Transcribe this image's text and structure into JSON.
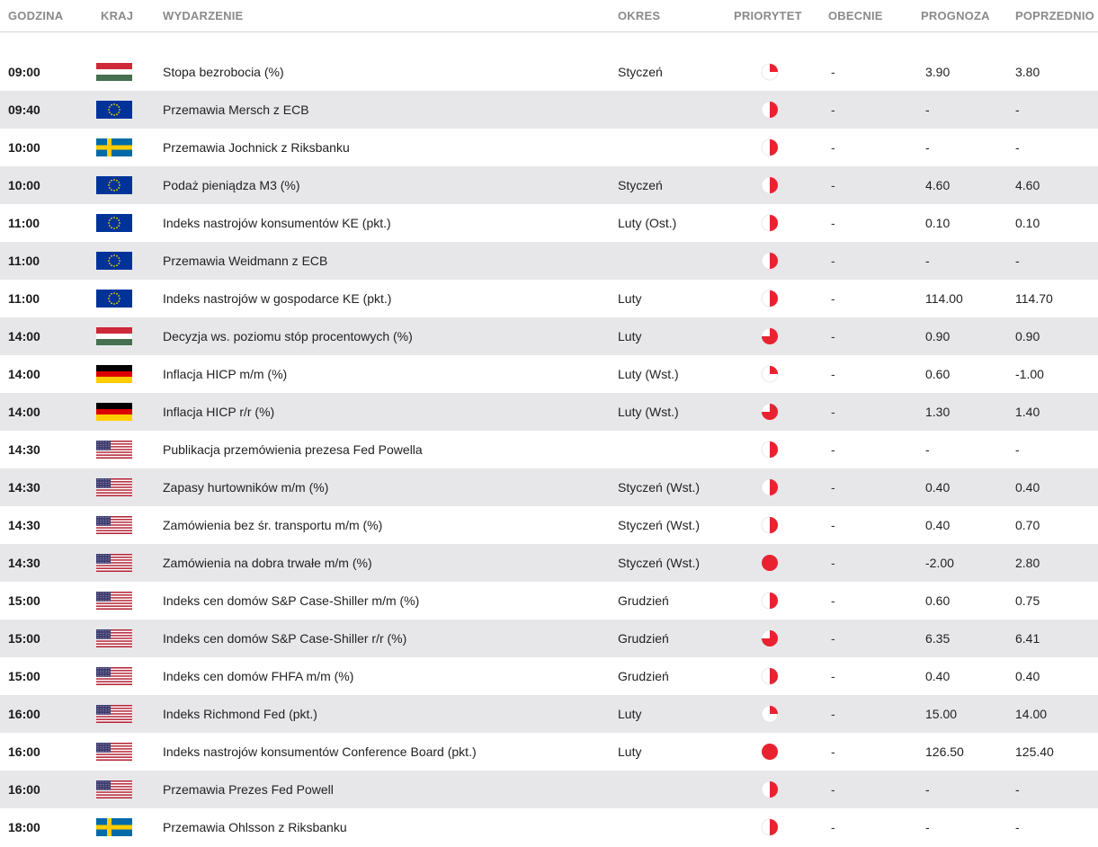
{
  "header": {
    "time": "GODZINA",
    "country": "KRAJ",
    "event": "WYDARZENIE",
    "period": "OKRES",
    "priority": "PRIORYTET",
    "current": "OBECNIE",
    "forecast": "PROGNOZA",
    "previous": "POPRZEDNIO"
  },
  "colors": {
    "priority_red": "#e8232f",
    "row_alt": "#e7e7ea",
    "header_text": "#8a8a8a"
  },
  "rows": [
    {
      "time": "09:00",
      "country": "hu",
      "event": "Stopa bezrobocia (%)",
      "period": "Styczeń",
      "priority": 1,
      "current": "-",
      "forecast": "3.90",
      "previous": "3.80"
    },
    {
      "time": "09:40",
      "country": "eu",
      "event": "Przemawia Mersch z ECB",
      "period": "",
      "priority": 2,
      "current": "-",
      "forecast": "-",
      "previous": "-"
    },
    {
      "time": "10:00",
      "country": "se",
      "event": "Przemawia Jochnick z Riksbanku",
      "period": "",
      "priority": 2,
      "current": "-",
      "forecast": "-",
      "previous": "-"
    },
    {
      "time": "10:00",
      "country": "eu",
      "event": "Podaż pieniądza M3 (%)",
      "period": "Styczeń",
      "priority": 2,
      "current": "-",
      "forecast": "4.60",
      "previous": "4.60"
    },
    {
      "time": "11:00",
      "country": "eu",
      "event": "Indeks nastrojów konsumentów KE (pkt.)",
      "period": "Luty (Ost.)",
      "priority": 2,
      "current": "-",
      "forecast": "0.10",
      "previous": "0.10"
    },
    {
      "time": "11:00",
      "country": "eu",
      "event": "Przemawia Weidmann z ECB",
      "period": "",
      "priority": 2,
      "current": "-",
      "forecast": "-",
      "previous": "-"
    },
    {
      "time": "11:00",
      "country": "eu",
      "event": "Indeks nastrojów w gospodarce KE (pkt.)",
      "period": "Luty",
      "priority": 2,
      "current": "-",
      "forecast": "114.00",
      "previous": "114.70"
    },
    {
      "time": "14:00",
      "country": "hu",
      "event": "Decyzja ws. poziomu stóp procentowych (%)",
      "period": "Luty",
      "priority": 3,
      "current": "-",
      "forecast": "0.90",
      "previous": "0.90"
    },
    {
      "time": "14:00",
      "country": "de",
      "event": "Inflacja HICP m/m (%)",
      "period": "Luty (Wst.)",
      "priority": 1,
      "current": "-",
      "forecast": "0.60",
      "previous": "-1.00"
    },
    {
      "time": "14:00",
      "country": "de",
      "event": "Inflacja HICP r/r (%)",
      "period": "Luty (Wst.)",
      "priority": 3,
      "current": "-",
      "forecast": "1.30",
      "previous": "1.40"
    },
    {
      "time": "14:30",
      "country": "us",
      "event": "Publikacja przemówienia prezesa Fed Powella",
      "period": "",
      "priority": 2,
      "current": "-",
      "forecast": "-",
      "previous": "-"
    },
    {
      "time": "14:30",
      "country": "us",
      "event": "Zapasy hurtowników m/m (%)",
      "period": "Styczeń (Wst.)",
      "priority": 2,
      "current": "-",
      "forecast": "0.40",
      "previous": "0.40"
    },
    {
      "time": "14:30",
      "country": "us",
      "event": "Zamówienia bez śr. transportu m/m (%)",
      "period": "Styczeń (Wst.)",
      "priority": 2,
      "current": "-",
      "forecast": "0.40",
      "previous": "0.70"
    },
    {
      "time": "14:30",
      "country": "us",
      "event": "Zamówienia na dobra trwałe m/m (%)",
      "period": "Styczeń (Wst.)",
      "priority": 4,
      "current": "-",
      "forecast": "-2.00",
      "previous": "2.80"
    },
    {
      "time": "15:00",
      "country": "us",
      "event": "Indeks cen domów S&P Case-Shiller m/m (%)",
      "period": "Grudzień",
      "priority": 2,
      "current": "-",
      "forecast": "0.60",
      "previous": "0.75"
    },
    {
      "time": "15:00",
      "country": "us",
      "event": "Indeks cen domów S&P Case-Shiller r/r (%)",
      "period": "Grudzień",
      "priority": 3,
      "current": "-",
      "forecast": "6.35",
      "previous": "6.41"
    },
    {
      "time": "15:00",
      "country": "us",
      "event": "Indeks cen domów FHFA m/m (%)",
      "period": "Grudzień",
      "priority": 2,
      "current": "-",
      "forecast": "0.40",
      "previous": "0.40"
    },
    {
      "time": "16:00",
      "country": "us",
      "event": "Indeks Richmond Fed (pkt.)",
      "period": "Luty",
      "priority": 1,
      "current": "-",
      "forecast": "15.00",
      "previous": "14.00"
    },
    {
      "time": "16:00",
      "country": "us",
      "event": "Indeks nastrojów konsumentów Conference Board (pkt.)",
      "period": "Luty",
      "priority": 4,
      "current": "-",
      "forecast": "126.50",
      "previous": "125.40"
    },
    {
      "time": "16:00",
      "country": "us",
      "event": "Przemawia Prezes Fed Powell",
      "period": "",
      "priority": 2,
      "current": "-",
      "forecast": "-",
      "previous": "-"
    },
    {
      "time": "18:00",
      "country": "se",
      "event": "Przemawia Ohlsson z Riksbanku",
      "period": "",
      "priority": 2,
      "current": "-",
      "forecast": "-",
      "previous": "-"
    }
  ]
}
